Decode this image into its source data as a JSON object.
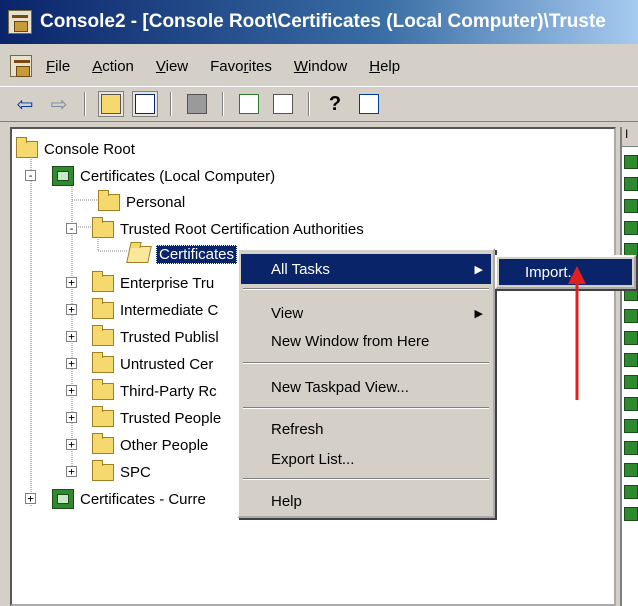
{
  "window": {
    "title": "Console2 - [Console Root\\Certificates (Local Computer)\\Truste"
  },
  "menubar": {
    "items": [
      {
        "label": "File"
      },
      {
        "label": "Action"
      },
      {
        "label": "View"
      },
      {
        "label": "Favorites"
      },
      {
        "label": "Window"
      },
      {
        "label": "Help"
      }
    ]
  },
  "toolbar": {
    "buttons": [
      "back-icon",
      "forward-icon",
      "up-folder-icon",
      "show-hide-tree-icon",
      "export-icon",
      "refresh-icon",
      "export-list-icon",
      "help-icon",
      "properties-icon"
    ]
  },
  "tree": {
    "nodes": [
      {
        "label": "Console Root"
      },
      {
        "label": "Certificates (Local Computer)"
      },
      {
        "label": "Personal"
      },
      {
        "label": "Trusted Root Certification Authorities"
      },
      {
        "label": "Certificates"
      },
      {
        "label": "Enterprise Tru"
      },
      {
        "label": "Intermediate C"
      },
      {
        "label": "Trusted Publisl"
      },
      {
        "label": "Untrusted Cer"
      },
      {
        "label": "Third-Party Rc"
      },
      {
        "label": "Trusted People"
      },
      {
        "label": "Other People"
      },
      {
        "label": "SPC"
      },
      {
        "label": "Certificates - Curre"
      }
    ]
  },
  "right_pane": {
    "header": "I"
  },
  "context_menu": {
    "items": [
      {
        "label": "All Tasks",
        "has_submenu": true
      },
      {
        "label": "View",
        "has_submenu": true
      },
      {
        "label": "New Window from Here"
      },
      {
        "label": "New Taskpad View..."
      },
      {
        "label": "Refresh"
      },
      {
        "label": "Export List..."
      },
      {
        "label": "Help"
      }
    ],
    "submenu": {
      "items": [
        {
          "label": "Import..."
        }
      ]
    }
  },
  "colors": {
    "highlight": "#0a246a",
    "annotation_arrow": "#e02020"
  }
}
